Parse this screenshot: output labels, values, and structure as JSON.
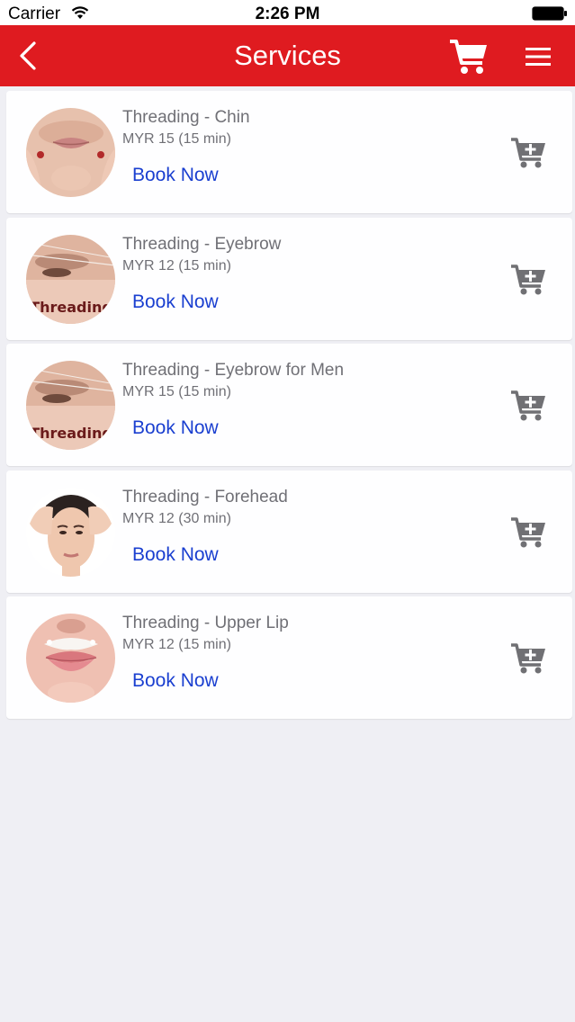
{
  "status_bar": {
    "carrier": "Carrier",
    "time": "2:26 PM"
  },
  "navbar": {
    "title": "Services"
  },
  "colors": {
    "brand": "#df1b20",
    "link": "#1a3fd0",
    "text_gray": "#707076",
    "cart_icon": "#707074"
  },
  "services": [
    {
      "name": "Threading - Chin",
      "price": "MYR 15 (15 min)",
      "book_label": "Book Now",
      "icon": "chin-photo"
    },
    {
      "name": "Threading - Eyebrow",
      "price": "MYR 12 (15 min)",
      "book_label": "Book Now",
      "icon": "eyebrow-photo",
      "image_caption": "Threading"
    },
    {
      "name": "Threading - Eyebrow for Men",
      "price": "MYR 15 (15 min)",
      "book_label": "Book Now",
      "icon": "eyebrow-photo",
      "image_caption": "Threading"
    },
    {
      "name": "Threading - Forehead",
      "price": "MYR 12 (30 min)",
      "book_label": "Book Now",
      "icon": "forehead-photo"
    },
    {
      "name": "Threading - Upper Lip",
      "price": "MYR 12 (15 min)",
      "book_label": "Book Now",
      "icon": "upper-lip-photo"
    }
  ]
}
